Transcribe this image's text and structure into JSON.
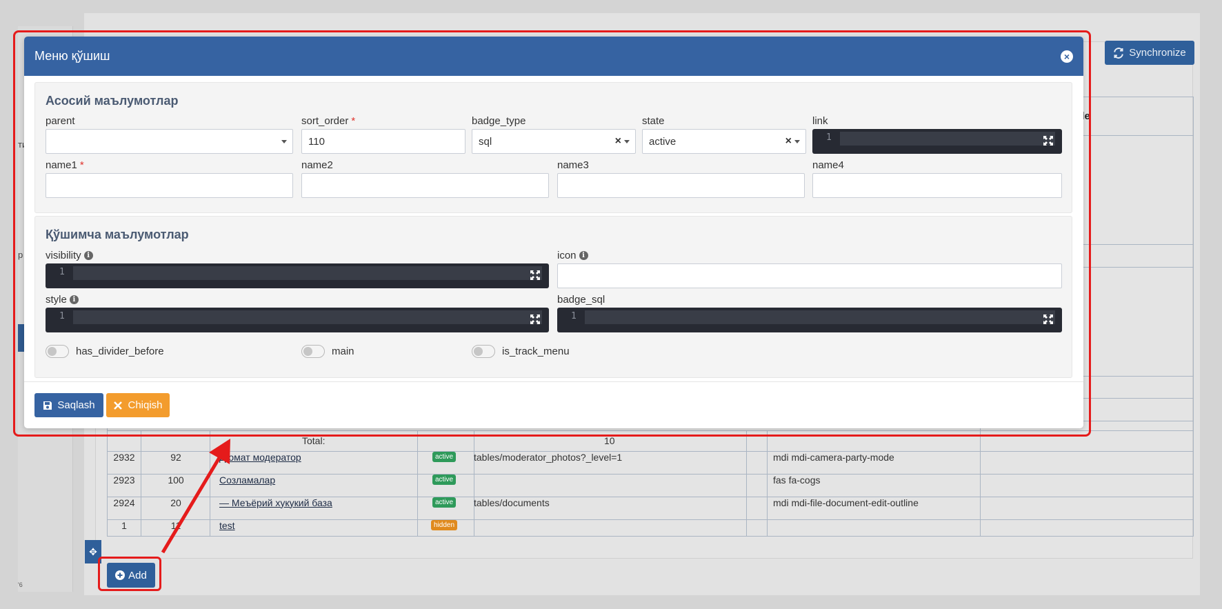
{
  "background": {
    "sync_label": "Synchronize",
    "type_header": "tyle",
    "side_text_1": "ти",
    "side_text_2": "р",
    "side_tiny": "'6",
    "total_label": "Total:",
    "total_value": "10",
    "rows": [
      {
        "id": "2932",
        "sort": "92",
        "name": "Д  омат модератор",
        "state": "active",
        "link": "tables/moderator_photos?_level=1",
        "icon": "mdi mdi-camera-party-mode"
      },
      {
        "id": "2923",
        "sort": "100",
        "name": "Созламалар",
        "state": "active",
        "link": "",
        "icon": "fas fa-cogs"
      },
      {
        "id": "2924",
        "sort": "20",
        "name": "— Меъёрий хукукий база",
        "state": "active",
        "link": "tables/documents",
        "icon": "mdi mdi-file-document-edit-outline"
      },
      {
        "id": "1",
        "sort": "11",
        "name": "test",
        "state": "hidden",
        "link": "",
        "icon": ""
      }
    ],
    "add_label": "Add"
  },
  "modal": {
    "title": "Меню қўшиш",
    "section1": {
      "title": "Асосий маълумотлар",
      "fields": {
        "parent": {
          "label": "parent",
          "value": ""
        },
        "sort_order": {
          "label": "sort_order",
          "value": "110",
          "required": "*"
        },
        "badge_type": {
          "label": "badge_type",
          "value": "sql"
        },
        "state": {
          "label": "state",
          "value": "active"
        },
        "link": {
          "label": "link",
          "line_number": "1"
        },
        "name1": {
          "label": "name1",
          "required": "*",
          "value": ""
        },
        "name2": {
          "label": "name2",
          "value": ""
        },
        "name3": {
          "label": "name3",
          "value": ""
        },
        "name4": {
          "label": "name4",
          "value": ""
        }
      }
    },
    "section2": {
      "title": "Қўшимча маълумотлар",
      "fields": {
        "visibility": {
          "label": "visibility",
          "line_number": "1"
        },
        "icon": {
          "label": "icon",
          "value": ""
        },
        "style": {
          "label": "style",
          "line_number": "1"
        },
        "badge_sql": {
          "label": "badge_sql",
          "line_number": "1"
        }
      },
      "toggles": {
        "has_divider_before": "has_divider_before",
        "main": "main",
        "is_track_menu": "is_track_menu"
      }
    },
    "buttons": {
      "save": "Saqlash",
      "exit": "Chiqish"
    }
  },
  "colors": {
    "header_blue": "#3663a2",
    "exit_orange": "#f39c2d",
    "annotation_red": "#e51b1b",
    "badge_active": "#2e9a5a",
    "badge_hidden": "#e08a1e"
  }
}
